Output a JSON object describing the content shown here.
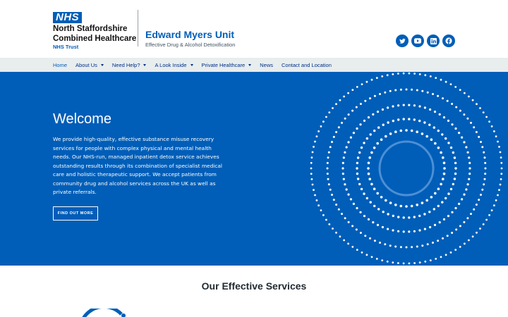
{
  "brand": {
    "nhs_badge": "NHS",
    "trust_line1": "North Staffordshire",
    "trust_line2": "Combined Healthcare",
    "trust_sub": "NHS Trust",
    "unit_title": "Edward Myers Unit",
    "unit_subtitle": "Effective Drug & Alcohol Detoxification",
    "accent_color": "#005eb8"
  },
  "socials": [
    {
      "icon": "twitter-icon"
    },
    {
      "icon": "youtube-icon"
    },
    {
      "icon": "linkedin-icon"
    },
    {
      "icon": "facebook-icon"
    }
  ],
  "nav": {
    "items": [
      {
        "label": "Home",
        "active": true,
        "dropdown": false
      },
      {
        "label": "About Us",
        "active": false,
        "dropdown": true
      },
      {
        "label": "Need Help?",
        "active": false,
        "dropdown": true
      },
      {
        "label": "A Look Inside",
        "active": false,
        "dropdown": true
      },
      {
        "label": "Private Healthcare",
        "active": false,
        "dropdown": true
      },
      {
        "label": "News",
        "active": false,
        "dropdown": false
      },
      {
        "label": "Contact and Location",
        "active": false,
        "dropdown": false
      }
    ]
  },
  "hero": {
    "title": "Welcome",
    "body": "We provide high-quality, effective substance misuse recovery services for people with complex physical and mental health needs. Our NHS-run, managed inpatient detox service achieves outstanding results through its combination of specialist medical care and holistic therapeutic support. We accept patients from community drug and alcohol services across the UK as well as private referrals.",
    "button_label": "FIND OUT MORE",
    "background_color": "#005eb8"
  },
  "services": {
    "title": "Our Effective Services"
  }
}
